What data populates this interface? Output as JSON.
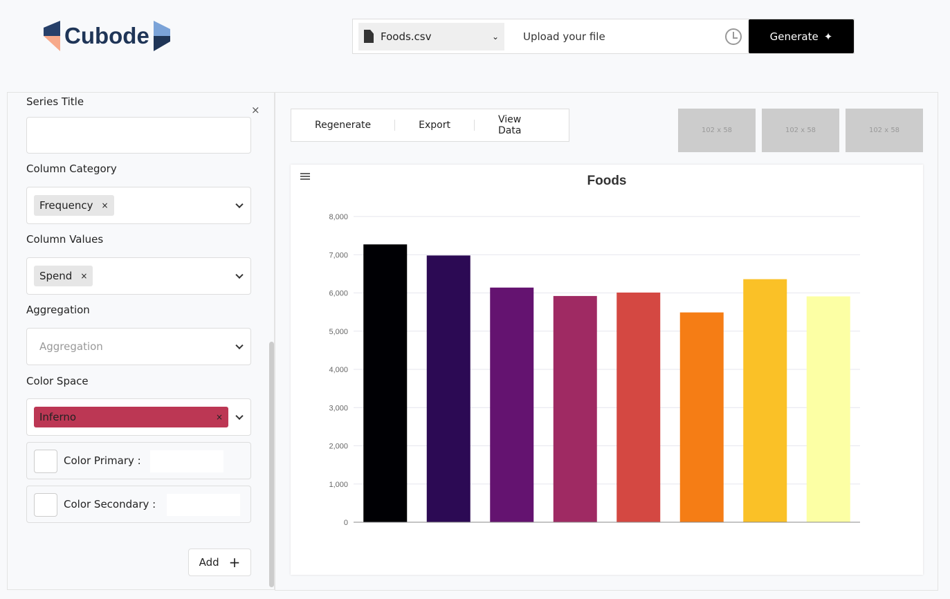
{
  "header": {
    "logo": "Cubode",
    "file_select": "Foods.csv",
    "upload_placeholder": "Upload your file",
    "generate": "Generate"
  },
  "sidebar": {
    "series_title_label": "Series Title",
    "series_title_value": "",
    "column_category_label": "Column Category",
    "column_category_chip": "Frequency",
    "column_values_label": "Column Values",
    "column_values_chip": "Spend",
    "aggregation_label": "Aggregation",
    "aggregation_placeholder": "Aggregation",
    "color_space_label": "Color Space",
    "color_space_chip": "Inferno",
    "color_space_color": "#bc3754",
    "color_primary_label": "Color Primary :",
    "color_secondary_label": "Color Secondary :",
    "add": "Add",
    "remove_chip": "×",
    "close": "×"
  },
  "toolbar": {
    "regenerate": "Regenerate",
    "export": "Export",
    "view_data": "View Data"
  },
  "thumbnails": [
    "102 x 58",
    "102 x 58",
    "102 x 58"
  ],
  "chart_data": {
    "type": "bar",
    "title": "Foods",
    "xlabel": "",
    "ylabel": "",
    "ylim": [
      0,
      8000
    ],
    "yticks": [
      "0",
      "1,000",
      "2,000",
      "3,000",
      "4,000",
      "5,000",
      "6,000",
      "7,000",
      "8,000"
    ],
    "grid": true,
    "values": [
      7270,
      6980,
      6140,
      5920,
      6010,
      5490,
      6360,
      5910
    ],
    "colors": [
      "#000004",
      "#2c0a54",
      "#641370",
      "#9f2a63",
      "#d44842",
      "#f57d15",
      "#fac127",
      "#fcffa4"
    ]
  }
}
